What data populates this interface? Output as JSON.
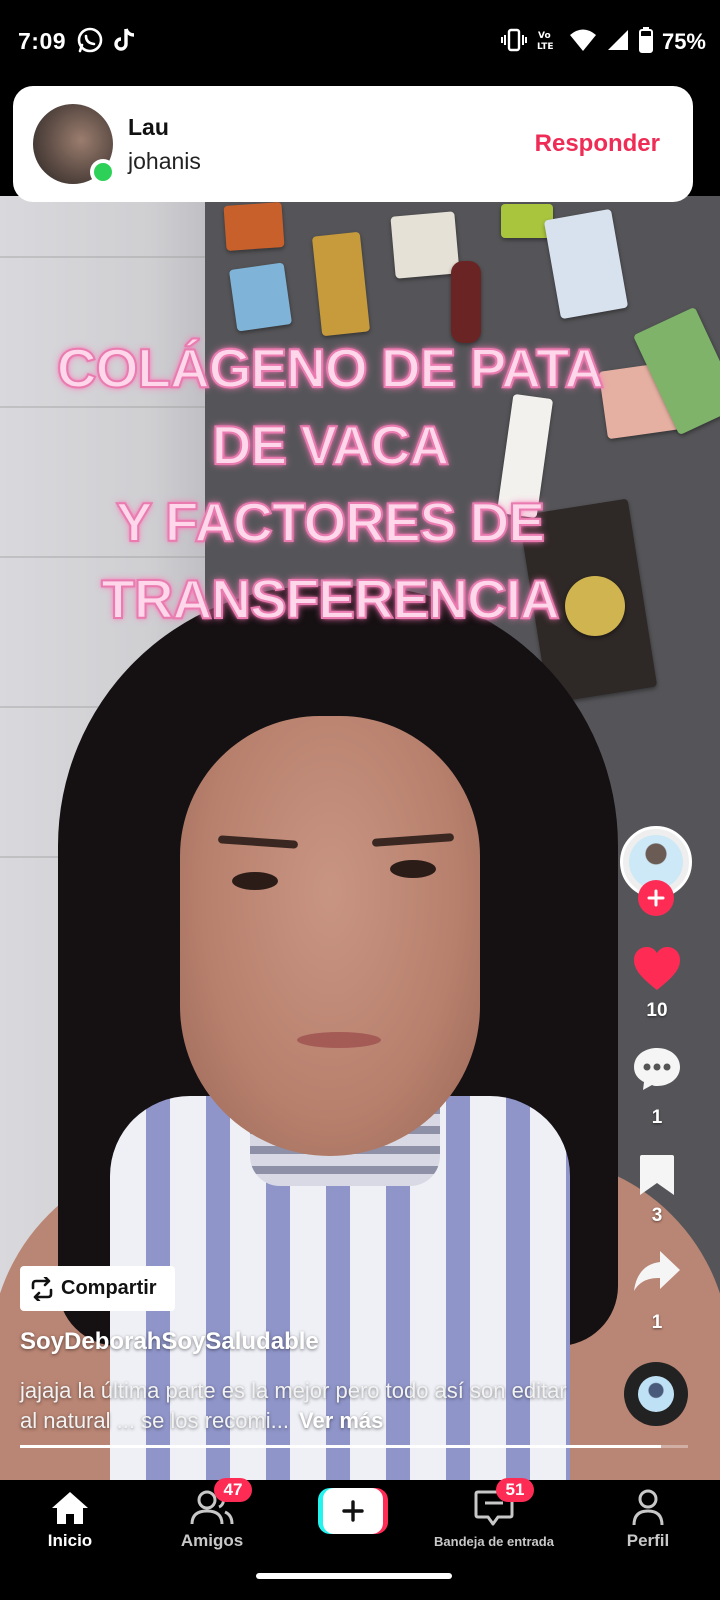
{
  "status_bar": {
    "time": "7:09",
    "battery": "75%",
    "icons": [
      "whatsapp-icon",
      "tiktok-icon",
      "vibrate-icon",
      "volte-icon",
      "wifi-icon",
      "signal-icon",
      "battery-icon"
    ]
  },
  "notification": {
    "sender": "Lau",
    "message": "johanis",
    "action_label": "Responder"
  },
  "video": {
    "overlay_lines": [
      "COLÁGENO DE PATA",
      "DE VACA⁠",
      "Y FACTORES DE",
      "TRANSFERENCIA"
    ],
    "progress": 0.96
  },
  "actions": {
    "likes": "10",
    "comments": "1",
    "saves": "3",
    "shares": "1"
  },
  "caption": {
    "share_label": "Compartir",
    "username": "SoyDeborahSoySaludable",
    "text": "jajaja la última parte es la mejor pero todo así son editar al natural ... se los recomi...",
    "more_label": "Ver más"
  },
  "nav": {
    "home": "Inicio",
    "friends": "Amigos",
    "friends_badge": "47",
    "inbox": "Bandeja de entrada",
    "inbox_badge": "51",
    "profile": "Perfil"
  },
  "colors": {
    "accent": "#fe2c55",
    "like": "#fe2c55",
    "online": "#2ed158",
    "reply": "#ee2c55"
  }
}
